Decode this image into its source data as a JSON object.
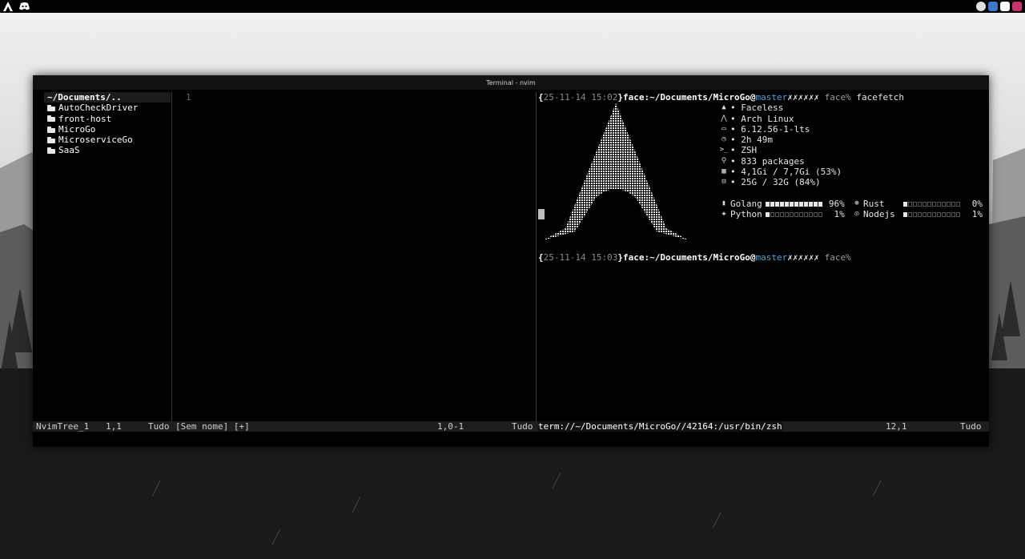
{
  "window": {
    "title": "Terminal - nvim"
  },
  "tree": {
    "root": "~/Documents/..",
    "items": [
      {
        "label": "AutoCheckDriver"
      },
      {
        "label": "front-host"
      },
      {
        "label": "MicroGo"
      },
      {
        "label": "MicroserviceGo"
      },
      {
        "label": "SaaS"
      }
    ]
  },
  "editor": {
    "line_number": "1"
  },
  "terminal": {
    "prompt1": {
      "brace_open": "{",
      "timestamp": "25-11-14 15:02",
      "brace_close": "}",
      "path": "face:~/Documents/MicroGo",
      "at": "@",
      "branch": "master",
      "marks": "✗✗✗✗✗✗",
      "user": "face%",
      "command": "facefetch"
    },
    "prompt2": {
      "brace_open": "{",
      "timestamp": "25-11-14 15:03",
      "brace_close": "}",
      "path": "face:~/Documents/MicroGo",
      "at": "@",
      "branch": "master",
      "marks": "✗✗✗✗✗✗",
      "user": "face%"
    },
    "sysinfo": [
      {
        "icon": "hat-icon",
        "glyph": "▲",
        "text": "• Faceless"
      },
      {
        "icon": "arch-logo-icon",
        "glyph": "⋀",
        "text": "• Arch Linux"
      },
      {
        "icon": "monitor-icon",
        "glyph": "▭",
        "text": "• 6.12.56-1-lts"
      },
      {
        "icon": "clock-icon",
        "glyph": "◷",
        "text": "• 2h 49m"
      },
      {
        "icon": "shell-prompt-icon",
        "glyph": ">_",
        "text": "• ZSH"
      },
      {
        "icon": "search-icon",
        "glyph": "⚲",
        "text": "• 833 packages"
      },
      {
        "icon": "memory-icon",
        "glyph": "▦",
        "text": "• 4,1Gi / 7,7Gi (53%)"
      },
      {
        "icon": "disk-icon",
        "glyph": "⊟",
        "text": "• 25G / 32G (84%)"
      }
    ],
    "languages": [
      [
        {
          "icon": "golang-icon",
          "glyph": "▮",
          "name": "Golang",
          "percent": 96,
          "label": "96%"
        },
        {
          "icon": "rust-icon",
          "glyph": "⊛",
          "name": "Rust",
          "percent": 0,
          "label": "0%"
        }
      ],
      [
        {
          "icon": "python-icon",
          "glyph": "✚",
          "name": "Python",
          "percent": 1,
          "label": "1%"
        },
        {
          "icon": "nodejs-icon",
          "glyph": "◎",
          "name": "Nodejs",
          "percent": 1,
          "label": "1%"
        }
      ]
    ]
  },
  "statusline": {
    "tree_name": "NvimTree_1",
    "tree_pos": "1,1",
    "tree_scroll": "Tudo",
    "editor_name": "[Sem nome] [+]",
    "editor_pos": "1,0-1",
    "editor_scroll": "Tudo",
    "term_name": "term://~/Documents/MicroGo//42164:/usr/bin/zsh",
    "term_pos": "12,1",
    "term_scroll": "Tudo"
  },
  "colors": {
    "accent": "#4fa3e0",
    "background": "#000000",
    "text": "#e6e6e6"
  }
}
